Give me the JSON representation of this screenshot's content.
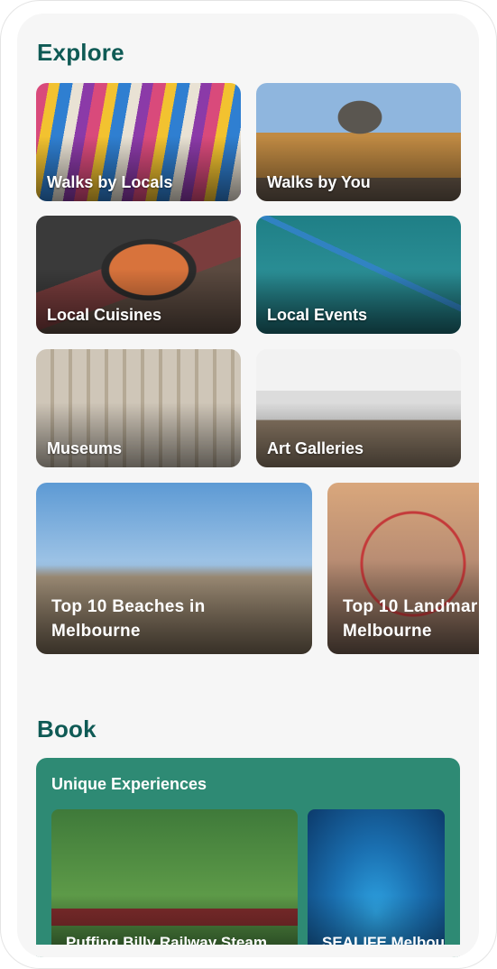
{
  "explore": {
    "title": "Explore",
    "tiles": [
      {
        "label": "Walks by Locals"
      },
      {
        "label": "Walks by You"
      },
      {
        "label": "Local Cuisines"
      },
      {
        "label": "Local Events"
      },
      {
        "label": "Museums"
      },
      {
        "label": "Art Galleries"
      }
    ],
    "featured": [
      {
        "label": "Top 10 Beaches in\nMelbourne"
      },
      {
        "label": "Top 10 Landmar\nMelbourne"
      }
    ]
  },
  "book": {
    "title": "Book",
    "panel_title": "Unique Experiences",
    "experiences": [
      {
        "label": "Puffing Billy Railway Steam"
      },
      {
        "label": "SEALIFE Melbou"
      }
    ]
  },
  "colors": {
    "heading": "#0f5a55",
    "book_panel": "#2e8a74",
    "background": "#f6f6f6"
  }
}
